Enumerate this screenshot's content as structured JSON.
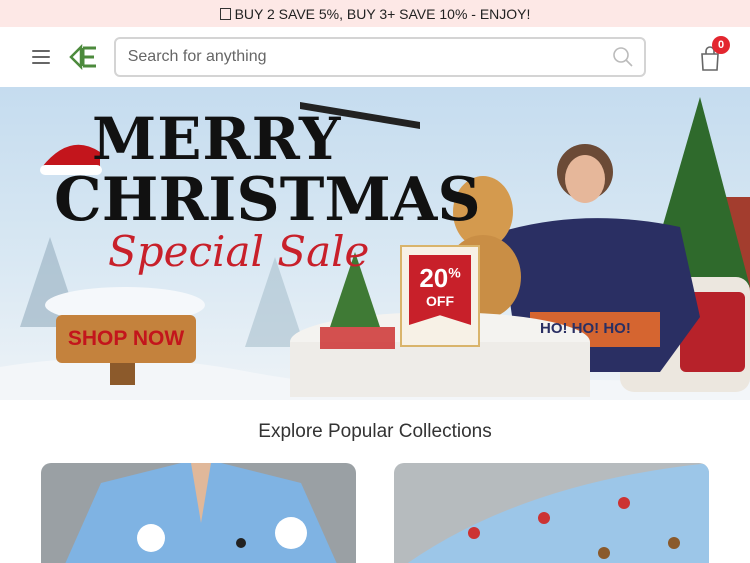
{
  "promo": {
    "text": "BUY 2 SAVE 5%, BUY 3+ SAVE 10% - ENJOY!",
    "icon": "gift-icon"
  },
  "header": {
    "search_placeholder": "Search for anything",
    "cart_count": "0",
    "icons": [
      "menu-icon",
      "logo",
      "search-icon",
      "cart-icon"
    ]
  },
  "hero": {
    "line1": "MERRY",
    "line2": "CHRISTMAS",
    "line3": "Special Sale",
    "cta": "SHOP NOW",
    "discount_value": "20",
    "discount_unit": "%",
    "discount_label": "OFF",
    "sweater_text": "HO! HO! HO!"
  },
  "collections": {
    "title": "Explore Popular Collections"
  },
  "colors": {
    "promo_bg": "#fde8e6",
    "accent_red": "#e3262f",
    "logo_green": "#4c8a3c"
  }
}
